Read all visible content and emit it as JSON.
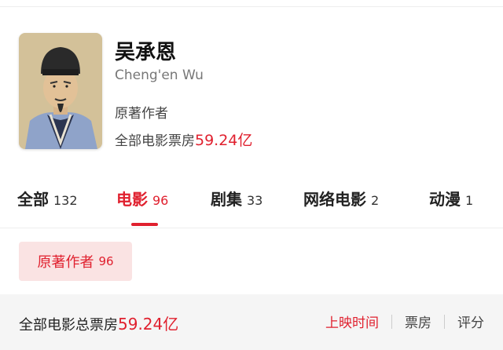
{
  "person": {
    "name": "吴承恩",
    "english_name": "Cheng'en Wu",
    "role": "原著作者",
    "box_office_label": "全部电影票房",
    "box_office_value": "59.24亿"
  },
  "tabs": [
    {
      "label": "全部",
      "count": "132",
      "active": false
    },
    {
      "label": "电影",
      "count": "96",
      "active": true
    },
    {
      "label": "剧集",
      "count": "33",
      "active": false
    },
    {
      "label": "网络电影",
      "count": "2",
      "active": false
    },
    {
      "label": "动漫",
      "count": "1",
      "active": false
    }
  ],
  "filter_chip": {
    "label": "原著作者",
    "count": "96"
  },
  "summary": {
    "label": "全部电影总票房",
    "value": "59.24亿"
  },
  "sort_options": [
    {
      "label": "上映时间",
      "active": true
    },
    {
      "label": "票房",
      "active": false
    },
    {
      "label": "评分",
      "active": false
    }
  ],
  "colors": {
    "accent": "#e0202e",
    "chip_bg": "#fae3e3",
    "bar_bg": "#f5f5f5"
  }
}
